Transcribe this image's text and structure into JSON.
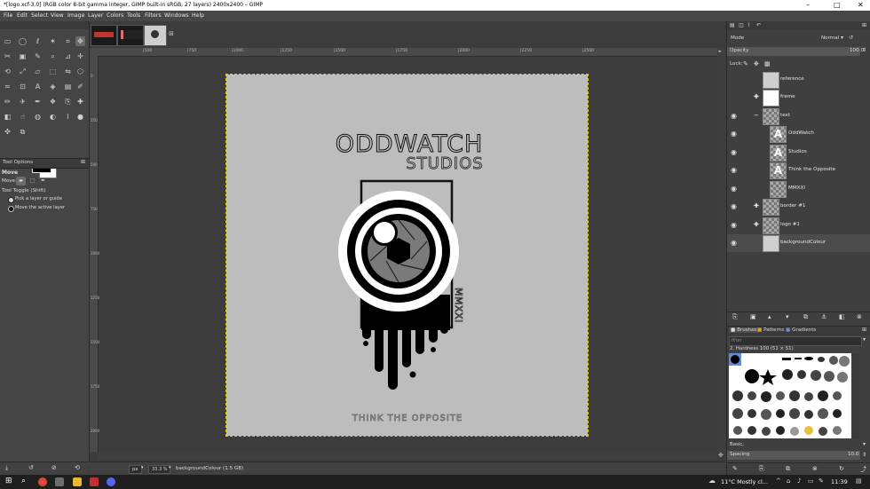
{
  "window": {
    "title": "*[logo.xcf-3.0] (RGB color 8-bit gamma integer, GIMP built-in sRGB, 27 layers) 2400x2400 – GIMP",
    "minimize_glyph": "–",
    "maximize_glyph": "□",
    "close_glyph": "✕"
  },
  "menu": [
    "File",
    "Edit",
    "Select",
    "View",
    "Image",
    "Layer",
    "Colors",
    "Tools",
    "Filters",
    "Windows",
    "Help"
  ],
  "ruler": {
    "h_ticks": [
      "|500",
      "|750",
      "|1000",
      "|1250",
      "|1500",
      "|1750",
      "|2000",
      "|2250",
      "|2500"
    ],
    "v_ticks": [
      "0",
      "250",
      "500",
      "750",
      "1000",
      "1250",
      "1500",
      "1750",
      "2000"
    ]
  },
  "tool_options": {
    "header": "Tool Options",
    "tool_name": "Move",
    "move_label": "Move:",
    "toggle_label": "Tool Toggle  (Shift)",
    "option_1": "Pick a layer or guide",
    "option_2": "Move the active layer"
  },
  "status": {
    "unit": "px",
    "zoom": "33.3 %",
    "layer_info": "backgroundColour (1.5 GB)"
  },
  "artwork": {
    "title": "ODDWATCH",
    "subtitle": "STUDIOS",
    "side_text": "MMXXI",
    "tagline": "THINK THE OPPOSITE"
  },
  "layers_panel": {
    "mode_label": "Mode",
    "mode_value": "Normal",
    "opacity_label": "Opacity",
    "opacity_value": "100.0",
    "lock_label": "Lock:",
    "layers": [
      {
        "name": "reference",
        "visible": false,
        "chain": "",
        "indent": 0,
        "thumb": "grey"
      },
      {
        "name": "frame",
        "visible": false,
        "chain": "✚",
        "indent": 0,
        "thumb": "white"
      },
      {
        "name": "text",
        "visible": true,
        "chain": "−",
        "indent": 0,
        "thumb": "checker"
      },
      {
        "name": "OddWatch",
        "visible": true,
        "chain": "",
        "indent": 1,
        "thumb": "text"
      },
      {
        "name": "Studios",
        "visible": true,
        "chain": "",
        "indent": 1,
        "thumb": "text"
      },
      {
        "name": "Think the Opposite",
        "visible": true,
        "chain": "",
        "indent": 1,
        "thumb": "text"
      },
      {
        "name": "MMXXI",
        "visible": true,
        "chain": "",
        "indent": 1,
        "thumb": "checker"
      },
      {
        "name": "border #1",
        "visible": true,
        "chain": "✚",
        "indent": 0,
        "thumb": "checker"
      },
      {
        "name": "logo #1",
        "visible": true,
        "chain": "✚",
        "indent": 0,
        "thumb": "checker"
      },
      {
        "name": "backgroundColour",
        "visible": true,
        "chain": "",
        "indent": 0,
        "thumb": "grey"
      }
    ]
  },
  "brushes_panel": {
    "tabs": [
      "Brushes",
      "Patterns",
      "Gradients"
    ],
    "filter_placeholder": "filter",
    "brush_name": "2. Hardness 100 (51 × 51)",
    "preset": "Basic,",
    "spacing_label": "Spacing",
    "spacing_value": "10.0"
  },
  "taskbar": {
    "weather": "11°C  Mostly cl...",
    "time": "11:39"
  },
  "colors": {
    "accent": "#5e8fd6",
    "canvas": "#bdbdbd",
    "panel": "#3f3f3f"
  }
}
